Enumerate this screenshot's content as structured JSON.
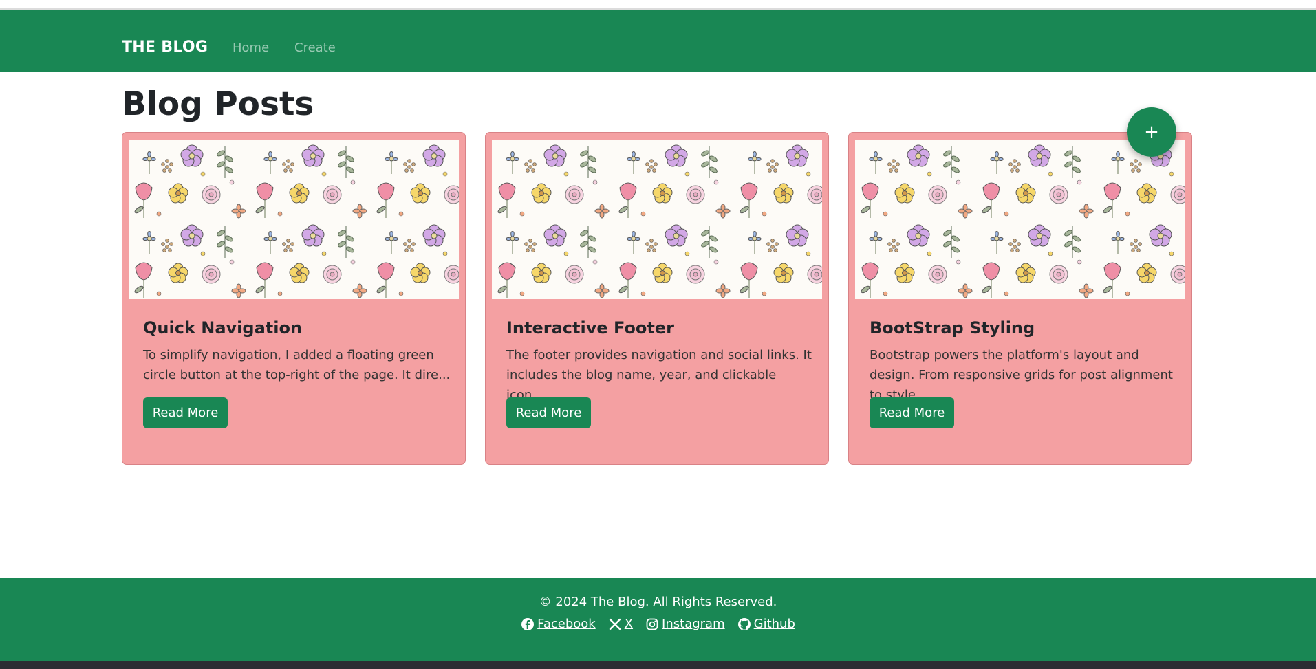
{
  "navbar": {
    "brand": "THE BLOG",
    "links": [
      {
        "label": "Home"
      },
      {
        "label": "Create"
      }
    ],
    "background": "#198754"
  },
  "main": {
    "title": "Blog Posts",
    "posts": [
      {
        "title": "Quick Navigation",
        "excerpt": "To simplify navigation, I added a floating green circle button at the top-right of the page. It dire...",
        "button_label": "Read More"
      },
      {
        "title": "Interactive Footer",
        "excerpt": "The footer provides navigation and social links. It includes the blog name, year, and clickable icon...",
        "button_label": "Read More"
      },
      {
        "title": "BootStrap Styling",
        "excerpt": "Bootstrap powers the platform's layout and design. From responsive grids for post alignment to style...",
        "button_label": "Read More"
      }
    ],
    "card_color": "#f4a0a2",
    "fab_label": "+"
  },
  "footer": {
    "copyright": "© 2024 The Blog. All Rights Reserved.",
    "social": [
      {
        "label": " Facebook",
        "icon": "facebook-icon"
      },
      {
        "label": " X",
        "icon": "x-icon"
      },
      {
        "label": " Instagram",
        "icon": "instagram-icon"
      },
      {
        "label": " Github",
        "icon": "github-icon"
      }
    ]
  },
  "colors": {
    "accent": "#198754",
    "card": "#f4a0a2"
  }
}
